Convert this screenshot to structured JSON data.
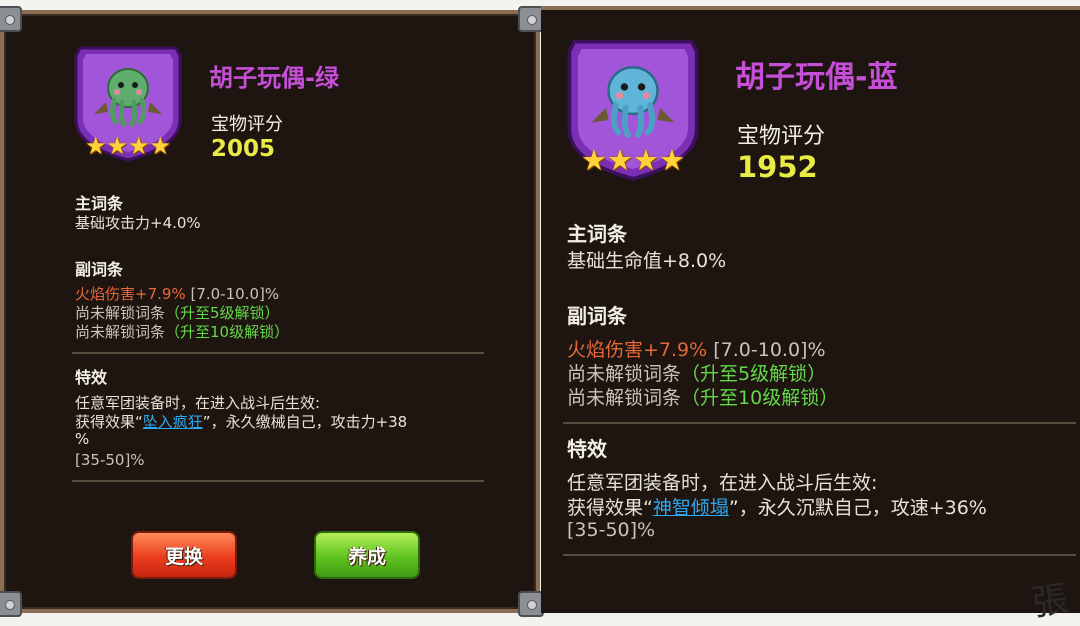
{
  "left_card": {
    "item_name": "胡子玩偶-绿",
    "score_label": "宝物评分",
    "score_value": "2005",
    "stars": 4,
    "main_stat_header": "主词条",
    "main_stat": "基础攻击力+4.0%",
    "sub_stat_header": "副词条",
    "sub_stat_1_value": "火焰伤害+7.9%",
    "sub_stat_1_range": "[7.0-10.0]%",
    "locked_label": "尚未解锁词条",
    "unlock_5": "（升至5级解锁）",
    "unlock_10": "（升至10级解锁）",
    "effect_header": "特效",
    "effect_line_1": "任意军团装备时，在进入战斗后生效:",
    "effect_line_2_prefix": "获得效果“",
    "effect_link": "坠入疯狂",
    "effect_line_2_suffix": "”，永久缴械自己，攻击力+38",
    "effect_line_3": "%",
    "effect_range": "[35-50]%",
    "button_replace": "更换",
    "button_develop": "养成",
    "creature_color": "#5fae6e"
  },
  "right_card": {
    "item_name": "胡子玩偶-蓝",
    "score_label": "宝物评分",
    "score_value": "1952",
    "stars": 4,
    "main_stat_header": "主词条",
    "main_stat": "基础生命值+8.0%",
    "sub_stat_header": "副词条",
    "sub_stat_1_value": "火焰伤害+7.9%",
    "sub_stat_1_range": "[7.0-10.0]%",
    "locked_label": "尚未解锁词条",
    "unlock_5": "（升至5级解锁）",
    "unlock_10": "（升至10级解锁）",
    "effect_header": "特效",
    "effect_line_1": "任意军团装备时，在进入战斗后生效:",
    "effect_line_2_prefix": "获得效果“",
    "effect_link": "神智倾塌",
    "effect_line_2_suffix": "”，永久沉默自己，攻速+36%",
    "effect_range": "[35-50]%",
    "creature_color": "#5fb4d8"
  },
  "signature": "張"
}
